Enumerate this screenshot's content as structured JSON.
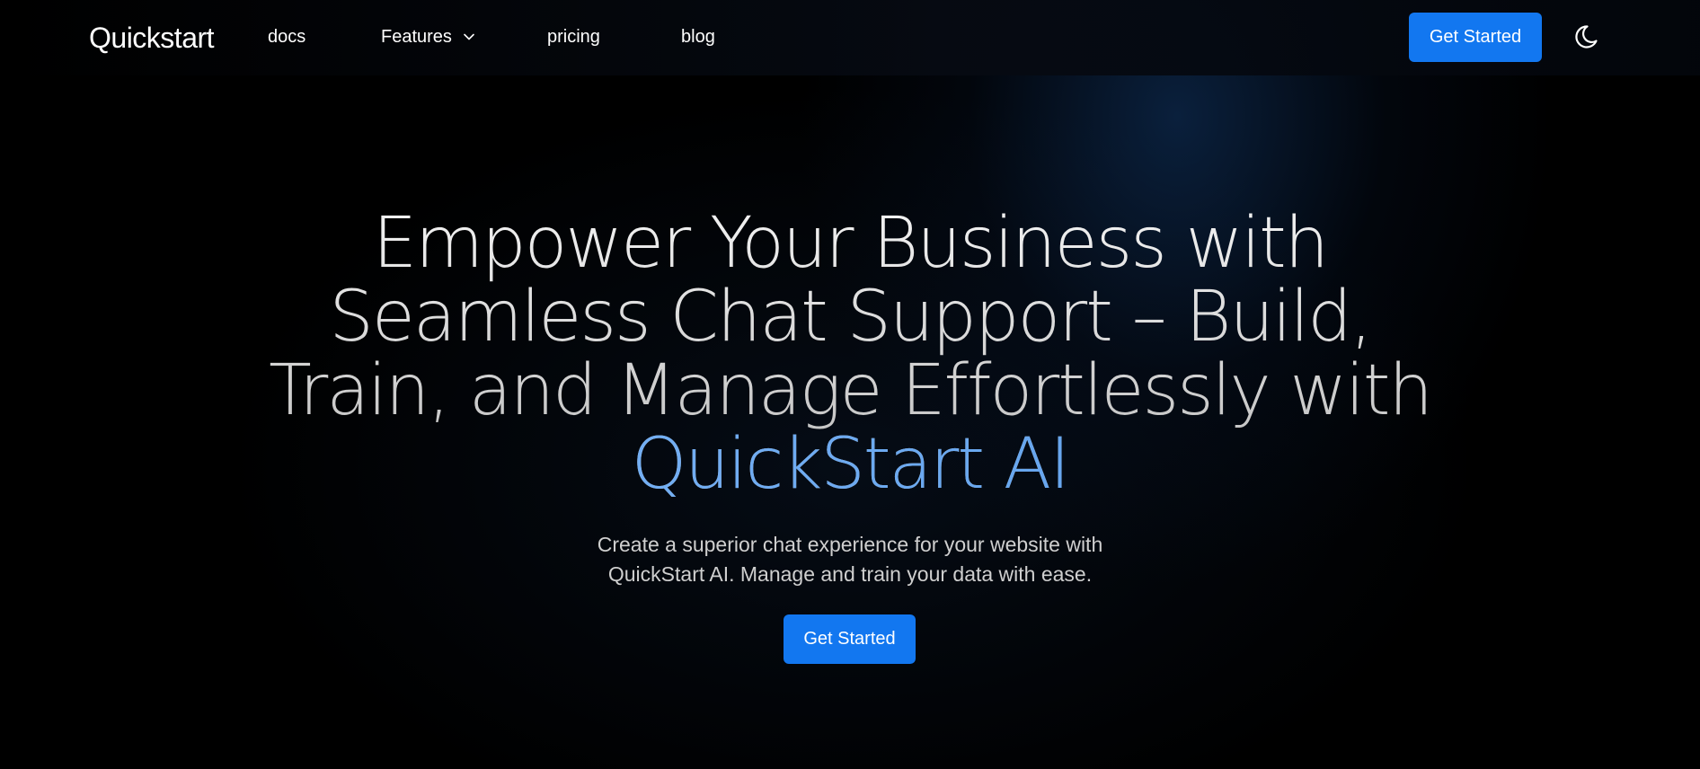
{
  "nav": {
    "brand": "Quickstart",
    "links": {
      "docs": "docs",
      "features": "Features",
      "pricing": "pricing",
      "blog": "blog"
    },
    "cta_label": "Get Started",
    "theme_toggle_icon": "moon-icon"
  },
  "hero": {
    "title_lines": [
      "Empower Your Business with",
      "Seamless Chat Support – Build,",
      "Train, and Manage Effortlessly with"
    ],
    "title_accent": "QuickStart AI",
    "subtitle_lines": [
      "Create a superior chat experience for your website with",
      "QuickStart AI. Manage and train your data with ease."
    ],
    "cta_label": "Get Started"
  },
  "colors": {
    "background": "#000000",
    "primary": "#1277f0",
    "accent_text": "#6aa8f2"
  }
}
